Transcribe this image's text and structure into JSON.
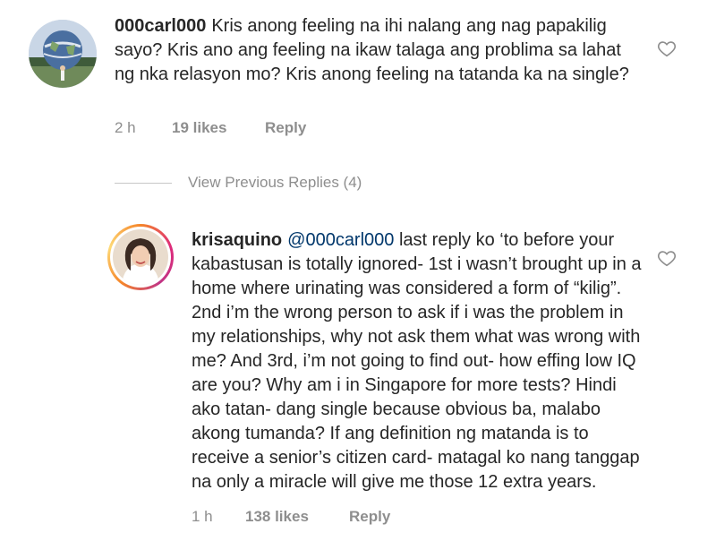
{
  "comments": [
    {
      "username": "000carl000",
      "text": "Kris anong feeling na ihi nalang ang nag papakilig sayo? Kris ano ang feeling na ikaw talaga ang problima sa lahat ng nka relasyon mo? Kris anong feeling na tatanda ka na single?",
      "time": "2 h",
      "likes": "19 likes",
      "reply_label": "Reply",
      "avatar_icon": "globe-sculpture-photo",
      "like_icon": "heart-outline-icon"
    }
  ],
  "view_previous_replies": "View Previous Replies (4)",
  "reply": {
    "username": "krisaquino",
    "mention": "@000carl000",
    "text": "last reply ko ‘to before your kabastusan is totally ignored- 1st i wasn’t brought up in a home where urinating was considered a form of “kilig”. 2nd i’m the wrong person to ask if i was the problem in my relationships, why not ask them what was wrong with me? And 3rd, i’m not going to find out- how effing low IQ are you? Why am i in Singapore for more tests? Hindi ako tatan- dang single because obvious ba, malabo akong tumanda? If ang definition ng matanda is to receive a senior’s citizen card- matagal ko nang tanggap na only a miracle will give me those 12 extra years.",
    "time": "1 h",
    "likes": "138 likes",
    "reply_label": "Reply",
    "avatar_icon": "profile-photo-with-story-ring",
    "like_icon": "heart-outline-icon"
  },
  "colors": {
    "text": "#262626",
    "meta": "#8e8e8e",
    "mention": "#00376b",
    "divider": "#c7c7c7",
    "heart": "#8e8e8e"
  }
}
